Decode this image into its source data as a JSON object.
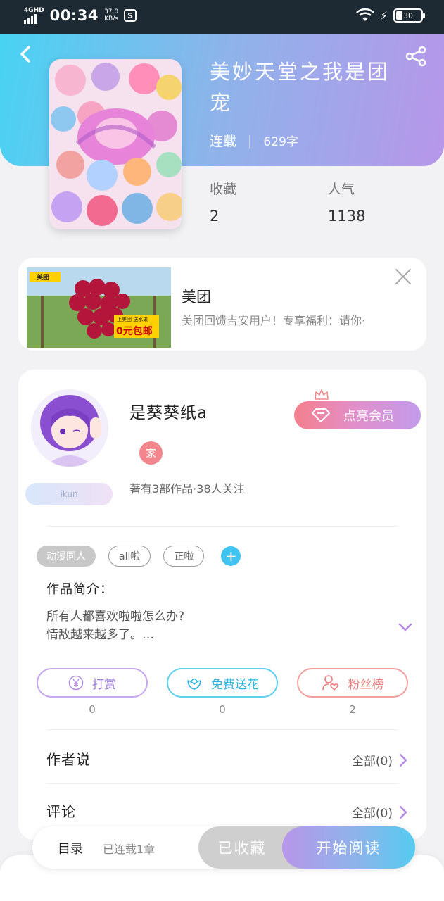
{
  "status_bar": {
    "network": "4GHD",
    "time": "00:34",
    "speed_value": "37.0",
    "speed_unit": "KB/s",
    "battery": "30"
  },
  "book": {
    "title": "美妙天堂之我是团宠",
    "status": "连载",
    "word_count": "629字",
    "favorites_label": "收藏",
    "favorites_value": "2",
    "popularity_label": "人气",
    "popularity_value": "1138"
  },
  "ad": {
    "image_brand": "美团",
    "image_slogan": "上美团 送水果",
    "image_promo": "0元包邮",
    "title": "美团",
    "description": "美团回馈吉安用户！专享福利：请你·"
  },
  "author": {
    "name": "是葵葵纸a",
    "badge": "家",
    "avatar_tag": "ikun",
    "info": "著有3部作品·38人关注",
    "vip_label": "点亮会员"
  },
  "tags": [
    "动漫同人",
    "all啦",
    "正啦"
  ],
  "intro": {
    "title": "作品简介：",
    "line1": "所有人都喜欢啦啦怎么办?",
    "line2": "情敌越来越多了。…"
  },
  "actions": [
    {
      "label": "打赏",
      "count": "0"
    },
    {
      "label": "免费送花",
      "count": "0"
    },
    {
      "label": "粉丝榜",
      "count": "2"
    }
  ],
  "rows": {
    "author_say": {
      "label": "作者说",
      "link": "全部(0)"
    },
    "comments": {
      "label": "评论",
      "link": "全部(0)"
    }
  },
  "bottom_bar": {
    "toc": "目录",
    "toc_status": "已连载1章",
    "favorite": "已收藏",
    "read": "开始阅读"
  },
  "colors": {
    "header_gradient_start": "#48d3f3",
    "header_gradient_end": "#b796e9",
    "reward": "#b58ae6",
    "flower": "#40c4ef",
    "fans": "#f08a8a"
  }
}
